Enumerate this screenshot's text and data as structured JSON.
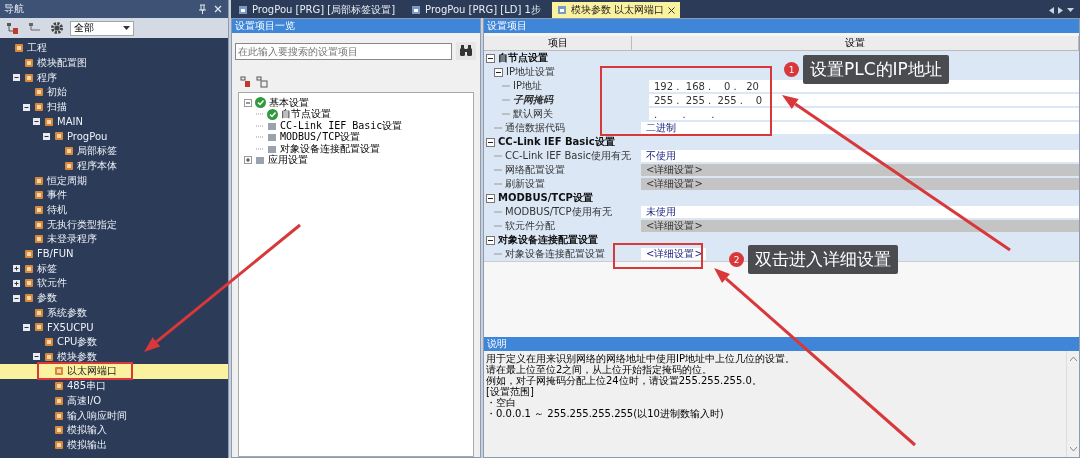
{
  "nav": {
    "title": "导航",
    "filter": "全部",
    "tree": [
      {
        "label": "工程",
        "selected": false,
        "children": [
          {
            "label": "模块配置图",
            "selected": false
          },
          {
            "label": "程序",
            "selected": false,
            "expanded": true,
            "children": [
              {
                "label": "初始",
                "selected": false
              },
              {
                "label": "扫描",
                "selected": false,
                "expanded": true,
                "children": [
                  {
                    "label": "MAIN",
                    "selected": false,
                    "expanded": true,
                    "children": [
                      {
                        "label": "ProgPou",
                        "selected": false,
                        "expanded": true,
                        "children": [
                          {
                            "label": "局部标签",
                            "selected": false
                          },
                          {
                            "label": "程序本体",
                            "selected": false
                          }
                        ]
                      }
                    ]
                  }
                ]
              },
              {
                "label": "恒定周期",
                "selected": false
              },
              {
                "label": "事件",
                "selected": false
              },
              {
                "label": "待机",
                "selected": false
              },
              {
                "label": "无执行类型指定",
                "selected": false
              },
              {
                "label": "未登录程序",
                "selected": false
              }
            ]
          },
          {
            "label": "FB/FUN",
            "selected": false
          },
          {
            "label": "标签",
            "selected": false,
            "expanded": false
          },
          {
            "label": "软元件",
            "selected": false,
            "expanded": false
          },
          {
            "label": "参数",
            "selected": false,
            "expanded": true,
            "children": [
              {
                "label": "系统参数",
                "selected": false
              },
              {
                "label": "FX5UCPU",
                "selected": false,
                "expanded": true,
                "children": [
                  {
                    "label": "CPU参数",
                    "selected": false
                  },
                  {
                    "label": "模块参数",
                    "selected": false,
                    "expanded": true,
                    "children": [
                      {
                        "label": "以太网端口",
                        "selected": true
                      },
                      {
                        "label": "485串口",
                        "selected": false
                      },
                      {
                        "label": "高速I/O",
                        "selected": false
                      },
                      {
                        "label": "输入响应时间",
                        "selected": false
                      },
                      {
                        "label": "模拟输入",
                        "selected": false
                      },
                      {
                        "label": "模拟输出",
                        "selected": false
                      }
                    ]
                  }
                ]
              }
            ]
          }
        ]
      }
    ]
  },
  "tabs": [
    {
      "label": "ProgPou [PRG] [局部标签设置]",
      "selected": false
    },
    {
      "label": "ProgPou [PRG] [LD] 1步",
      "selected": false
    },
    {
      "label": "模块参数 以太网端口",
      "selected": true
    }
  ],
  "settings_list": {
    "title": "设置项目一览",
    "search": {
      "placeholder": "在此输入要搜索的设置项目"
    },
    "tree": [
      {
        "label": "基本设置",
        "configured": true,
        "expanded": true,
        "children": [
          {
            "label": "自节点设置",
            "configured": true
          },
          {
            "label": "CC-Link IEF Basic设置",
            "configured": false
          },
          {
            "label": "MODBUS/TCP设置",
            "configured": false
          },
          {
            "label": "对象设备连接配置设置",
            "configured": false
          }
        ]
      },
      {
        "label": "应用设置",
        "configured": false,
        "expanded": false
      }
    ]
  },
  "settings": {
    "title": "设置项目",
    "columns": [
      "项目",
      "设置"
    ],
    "rows": [
      {
        "label": "自节点设置",
        "kind": "group",
        "expanded": true,
        "children": [
          {
            "label": "IP地址设置",
            "kind": "group",
            "expanded": true,
            "children": [
              {
                "label": "IP地址",
                "kind": "text",
                "emphasized": false,
                "value": "192 .  168 .    0 .   20"
              },
              {
                "label": "子网掩码",
                "kind": "text",
                "emphasized": true,
                "value": "255 .  255 .  255 .    0"
              },
              {
                "label": "默认网关",
                "kind": "text",
                "emphasized": false,
                "value": ".        .        ."
              }
            ]
          },
          {
            "label": "通信数据代码",
            "kind": "option",
            "emphasized": false,
            "value": "二进制"
          }
        ]
      },
      {
        "label": "CC-Link IEF Basic设置",
        "kind": "group",
        "expanded": true,
        "children": [
          {
            "label": "CC-Link IEF Basic使用有无",
            "kind": "option",
            "emphasized": false,
            "value": "不使用"
          },
          {
            "label": "网络配置设置",
            "kind": "button",
            "emphasized": false,
            "value": "<详细设置>"
          },
          {
            "label": "刷新设置",
            "kind": "button",
            "emphasized": false,
            "value": "<详细设置>"
          }
        ]
      },
      {
        "label": "MODBUS/TCP设置",
        "kind": "group",
        "expanded": true,
        "children": [
          {
            "label": "MODBUS/TCP使用有无",
            "kind": "option",
            "emphasized": false,
            "value": "未使用"
          },
          {
            "label": "软元件分配",
            "kind": "button",
            "emphasized": false,
            "value": "<详细设置>"
          }
        ]
      },
      {
        "label": "对象设备连接配置设置",
        "kind": "group",
        "expanded": true,
        "children": [
          {
            "label": "对象设备连接配置设置",
            "kind": "link",
            "emphasized": false,
            "value": "<详细设置>"
          }
        ]
      }
    ]
  },
  "description": {
    "title": "说明",
    "lines": [
      "用于定义在用来识别网络的网络地址中使用IP地址中上位几位的设置。",
      "请在最上位至位2之间，从上位开始指定掩码的位。",
      "例如，对子网掩码分配上位24位时，请设置255.255.255.0。",
      "[设置范围]",
      "・空白",
      "・0.0.0.1 ～ 255.255.255.255(以10进制数输入时)"
    ]
  },
  "callouts": [
    {
      "badge": "1",
      "text": "设置PLC的IP地址"
    },
    {
      "badge": "2",
      "text": "双击进入详细设置"
    }
  ]
}
